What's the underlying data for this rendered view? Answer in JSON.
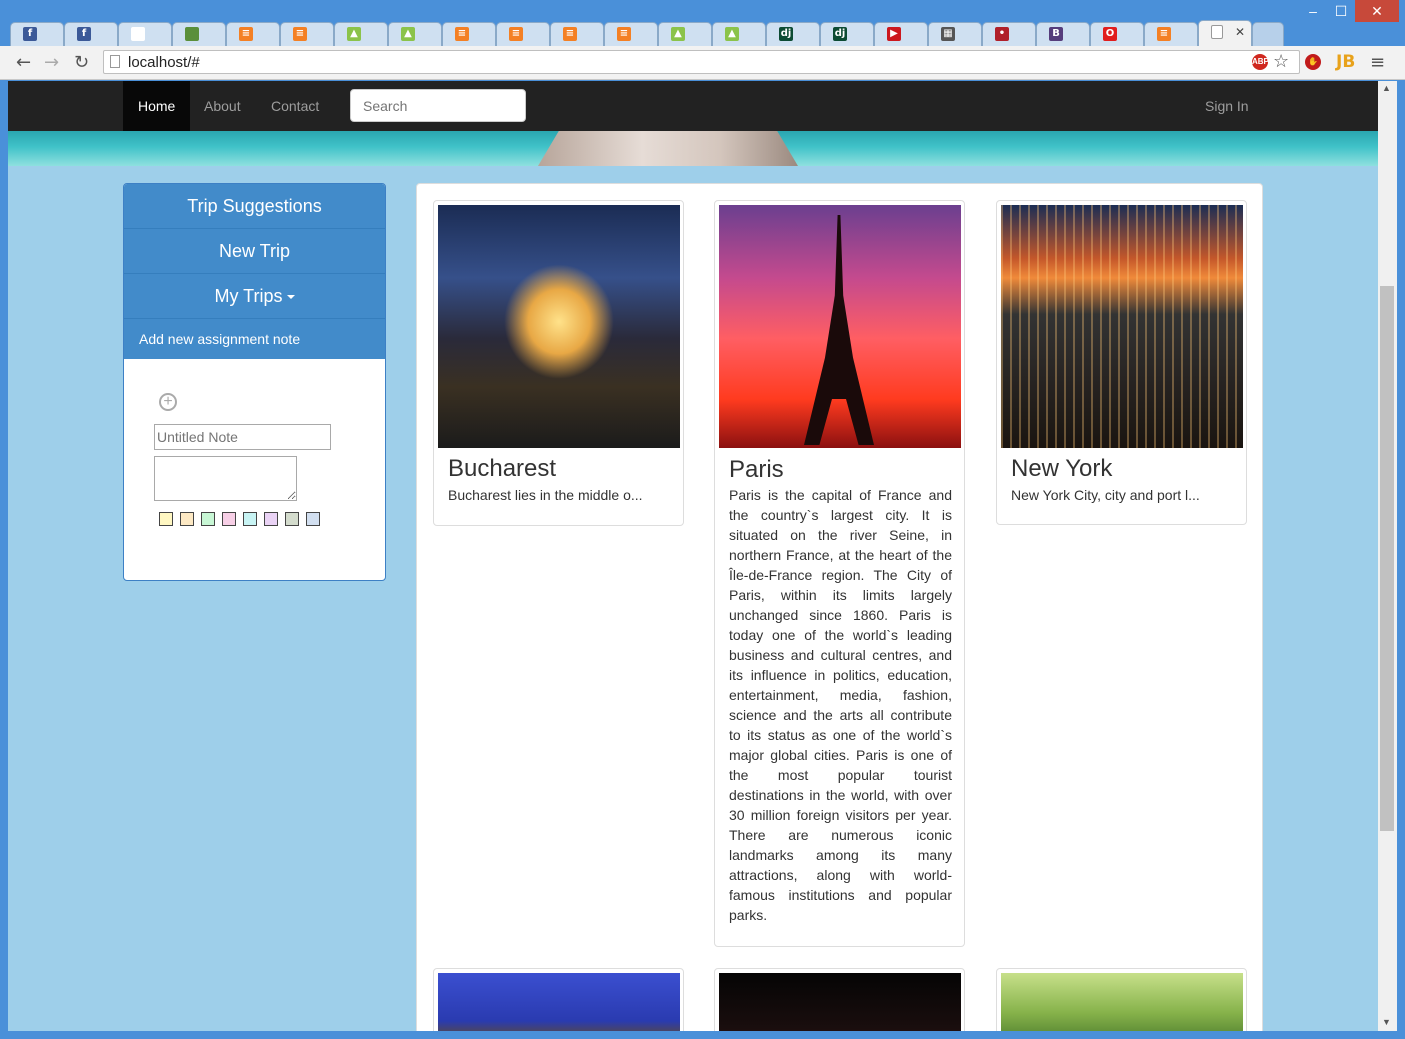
{
  "browser": {
    "tabs": [
      {
        "icon": "facebook-icon",
        "glyph": "f",
        "color": "#3b5998"
      },
      {
        "icon": "facebook-icon",
        "glyph": "f",
        "color": "#3b5998"
      },
      {
        "icon": "blank-page-icon",
        "glyph": "",
        "color": "#ffffff"
      },
      {
        "icon": "book-icon",
        "glyph": "",
        "color": "#5a8f3a"
      },
      {
        "icon": "stackoverflow-icon",
        "glyph": "≡",
        "color": "#f48024"
      },
      {
        "icon": "stackoverflow-icon",
        "glyph": "≡",
        "color": "#f48024"
      },
      {
        "icon": "android-icon",
        "glyph": "▲",
        "color": "#8bc34a"
      },
      {
        "icon": "android-icon",
        "glyph": "▲",
        "color": "#8bc34a"
      },
      {
        "icon": "stackoverflow-icon",
        "glyph": "≡",
        "color": "#f48024"
      },
      {
        "icon": "stackoverflow-icon",
        "glyph": "≡",
        "color": "#f48024"
      },
      {
        "icon": "stackoverflow-icon",
        "glyph": "≡",
        "color": "#f48024"
      },
      {
        "icon": "stackoverflow-icon",
        "glyph": "≡",
        "color": "#f48024"
      },
      {
        "icon": "android-icon",
        "glyph": "▲",
        "color": "#8bc34a"
      },
      {
        "icon": "android-icon",
        "glyph": "▲",
        "color": "#8bc34a"
      },
      {
        "icon": "django-icon",
        "glyph": "dj",
        "color": "#0c4b33"
      },
      {
        "icon": "django-icon",
        "glyph": "dj",
        "color": "#0c4b33"
      },
      {
        "icon": "youtube-icon",
        "glyph": "▶",
        "color": "#cc181e"
      },
      {
        "icon": "grid-icon",
        "glyph": "▦",
        "color": "#555555"
      },
      {
        "icon": "dots-icon",
        "glyph": "•",
        "color": "#b0202a"
      },
      {
        "icon": "bootstrap-icon",
        "glyph": "B",
        "color": "#563d7c"
      },
      {
        "icon": "oracle-icon",
        "glyph": "O",
        "color": "#e11d1d"
      },
      {
        "icon": "stackoverflow-icon",
        "glyph": "≡",
        "color": "#f48024"
      }
    ],
    "url": "localhost/#"
  },
  "navbar": {
    "items": [
      "Home",
      "About",
      "Contact"
    ],
    "search_placeholder": "Search",
    "sign_in": "Sign In"
  },
  "sidebar": {
    "buttons": [
      "Trip Suggestions",
      "New Trip",
      "My Trips"
    ],
    "note_header": "Add new assignment note",
    "note_title_placeholder": "Untitled Note",
    "swatch_colors": [
      "#fff7c2",
      "#fde9c4",
      "#c8f7d5",
      "#f7cfe6",
      "#c8f4f4",
      "#ead3f5",
      "#d4dccd",
      "#d2dff0"
    ]
  },
  "cards": [
    {
      "title": "Bucharest",
      "description": "Bucharest lies in the middle o..."
    },
    {
      "title": "Paris",
      "description": "Paris is the capital of France and the country`s largest city. It is situated on the river Seine, in northern France, at the heart of the Île-de-France region. The City of Paris, within its limits largely unchanged since 1860. Paris is today one of the world`s leading business and cultural centres, and its influence in politics, education, entertainment, media, fashion, science and the arts all contribute to its status as one of the world`s major global cities. Paris is one of the most popular tourist destinations in the world, with over 30 million foreign visitors per year. There are numerous iconic landmarks among its many attractions, along with world-famous institutions and popular parks."
    },
    {
      "title": "New York",
      "description": "New York City, city and port l..."
    }
  ]
}
